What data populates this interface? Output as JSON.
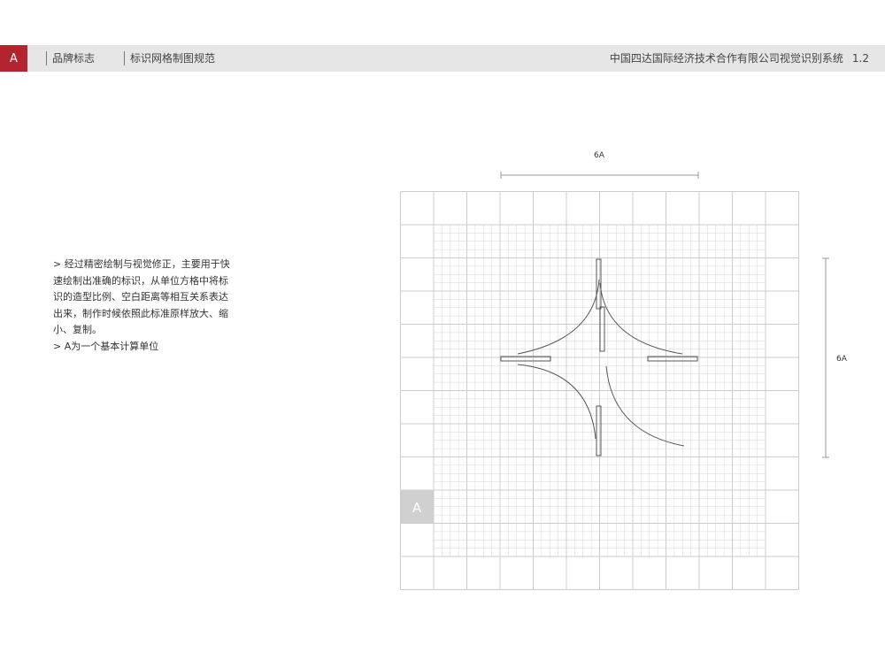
{
  "header": {
    "badge": "A",
    "section": "品牌标志",
    "subsection": "标识网格制图规范",
    "company": "中国四达国际经济技术合作有限公司视觉识别系统",
    "page_number": "1.2"
  },
  "description": {
    "paragraph_1": "> 经过精密绘制与视觉修正，主要用于快速绘制出准确的标识，从单位方格中将标识的造型比例、空白距离等相互关系表达出来，制作时候依照此标准原样放大、缩小、复制。",
    "paragraph_2": "> A为一个基本计算单位"
  },
  "figure": {
    "width_label": "6A",
    "height_label": "6A",
    "unit_label": "A",
    "colors": {
      "grid_line": "#cccccc",
      "fine_grid": "#d6d6d6",
      "logo_stroke": "#555555",
      "unit_cell": "#d0d0d0"
    }
  }
}
